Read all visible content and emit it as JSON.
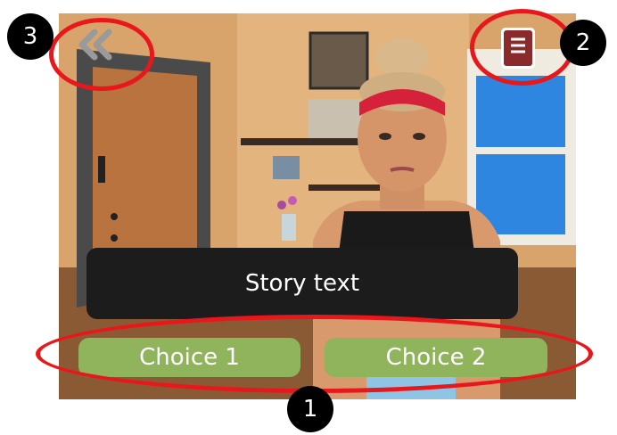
{
  "story": {
    "text": "Story text"
  },
  "choices": [
    {
      "label": "Choice 1"
    },
    {
      "label": "Choice 2"
    }
  ],
  "buttons": {
    "back_icon": "double-chevron-left-icon",
    "journal_icon": "book-icon"
  },
  "annotations": {
    "marker_1": "1",
    "marker_2": "2",
    "marker_3": "3"
  },
  "colors": {
    "annotation_ring": "#e8171c",
    "choice_button": "#8fb45c",
    "story_box": "#1c1c1c"
  }
}
